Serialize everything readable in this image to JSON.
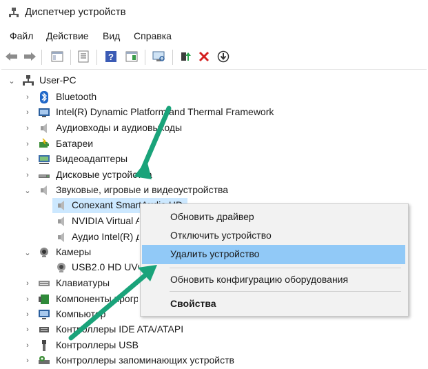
{
  "window": {
    "title": "Диспетчер устройств"
  },
  "menubar": [
    "Файл",
    "Действие",
    "Вид",
    "Справка"
  ],
  "toolbar": {
    "icons": [
      "back-arrow-icon",
      "forward-arrow-icon",
      "show-hide-tree-icon",
      "properties-icon",
      "help-icon",
      "console-view-icon",
      "scan-hardware-icon",
      "update-driver-icon",
      "uninstall-x-icon",
      "disable-device-icon"
    ]
  },
  "tree": {
    "root": "User-PC",
    "categories": [
      {
        "label": "Bluetooth",
        "icon": "bluetooth-icon"
      },
      {
        "label": "Intel(R) Dynamic Platform and Thermal Framework",
        "icon": "computer-board-icon"
      },
      {
        "label": "Аудиовходы и аудиовыходы",
        "icon": "speaker-icon"
      },
      {
        "label": "Батареи",
        "icon": "battery-icon"
      },
      {
        "label": "Видеоадаптеры",
        "icon": "display-adapter-icon"
      },
      {
        "label": "Дисковые устройства",
        "icon": "disk-drive-icon"
      },
      {
        "label": "Звуковые, игровые и видеоустройства",
        "icon": "sound-device-icon"
      }
    ],
    "sound_children": [
      {
        "label": "Conexant SmartAudio HD",
        "icon": "speaker-icon"
      },
      {
        "label": "NVIDIA Virtual Audio Device",
        "icon": "speaker-icon"
      },
      {
        "label": "Аудио Intel(R) для дисплеев",
        "icon": "speaker-icon"
      }
    ],
    "cameras": {
      "label": "Камеры",
      "icon": "camera-icon"
    },
    "camera_children": [
      {
        "label": "USB2.0 HD UVC WebCam",
        "icon": "webcam-icon"
      }
    ],
    "more_categories": [
      {
        "label": "Клавиатуры",
        "icon": "keyboard-icon"
      },
      {
        "label": "Компоненты программного обеспечения",
        "icon": "software-component-icon"
      },
      {
        "label": "Компьютер",
        "icon": "computer-icon"
      },
      {
        "label": "Контроллеры IDE ATA/ATAPI",
        "icon": "ide-controller-icon"
      },
      {
        "label": "Контроллеры USB",
        "icon": "usb-icon"
      },
      {
        "label": "Контроллеры запоминающих устройств",
        "icon": "storage-controller-icon"
      }
    ]
  },
  "context_menu": {
    "items": [
      "Обновить драйвер",
      "Отключить устройство",
      "Удалить устройство",
      "Обновить конфигурацию оборудования",
      "Свойства"
    ]
  },
  "colors": {
    "selection": "#cce8ff",
    "menu_hover": "#91c9f7",
    "arrow": "#1aa37a"
  }
}
